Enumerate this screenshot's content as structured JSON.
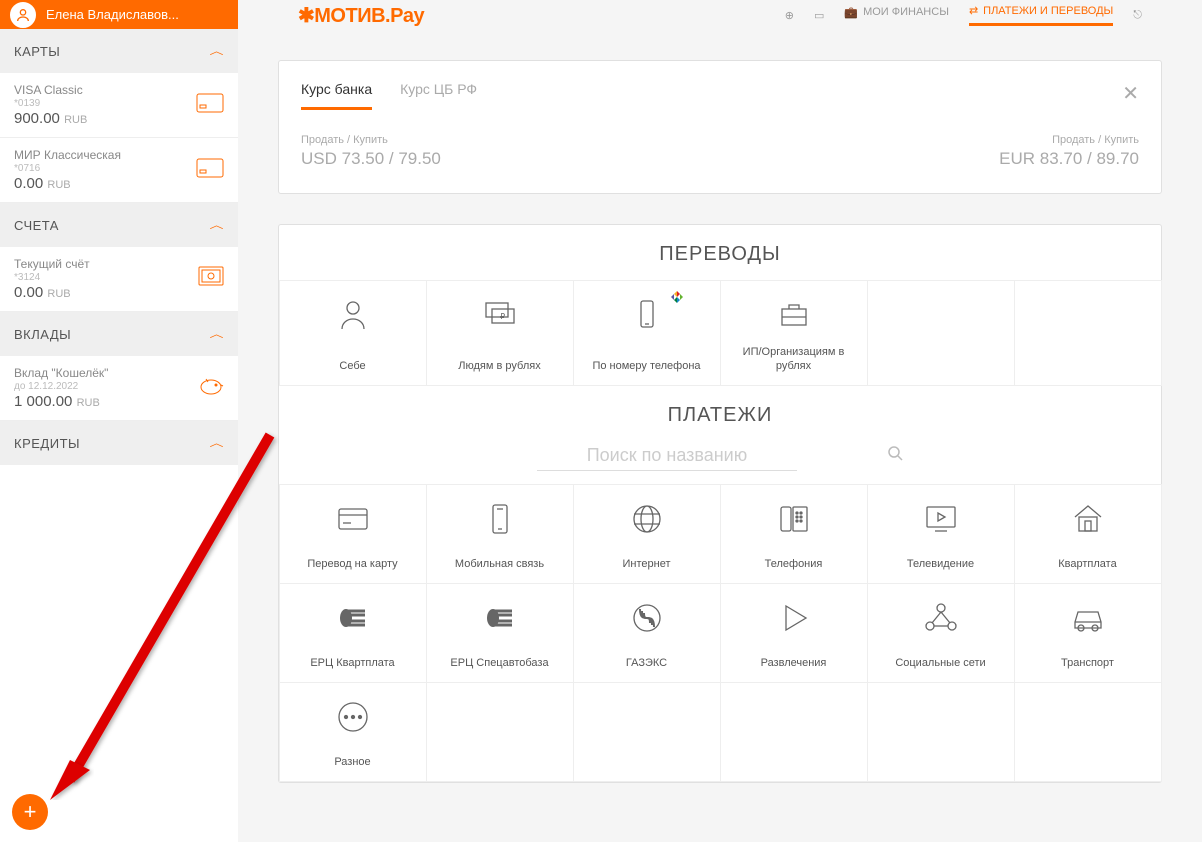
{
  "user": {
    "name": "Елена Владиславов..."
  },
  "logo": "✱МОТИВ.Pay",
  "topnav": {
    "finance": "МОИ ФИНАНСЫ",
    "payments": "ПЛАТЕЖИ И ПЕРЕВОДЫ"
  },
  "sidebar": {
    "sections": {
      "cards": "КАРТЫ",
      "accounts": "СЧЕТА",
      "deposits": "ВКЛАДЫ",
      "credits": "КРЕДИТЫ"
    },
    "cards": [
      {
        "name": "VISA Classic",
        "num": "*0139",
        "balance": "900.00",
        "cur": "RUB"
      },
      {
        "name": "МИР Классическая",
        "num": "*0716",
        "balance": "0.00",
        "cur": "RUB"
      }
    ],
    "accounts": [
      {
        "name": "Текущий счёт",
        "num": "*3124",
        "balance": "0.00",
        "cur": "RUB"
      }
    ],
    "deposits": [
      {
        "name": "Вклад \"Кошелёк\"",
        "num": "до 12.12.2022",
        "balance": "1 000.00",
        "cur": "RUB"
      }
    ]
  },
  "rates": {
    "tabs": {
      "bank": "Курс банка",
      "cbrf": "Курс ЦБ РФ"
    },
    "label": "Продать / Купить",
    "usd": "USD 73.50 / 79.50",
    "eur": "EUR 83.70 / 89.70"
  },
  "transfers": {
    "title": "ПЕРЕВОДЫ",
    "items": [
      "Себе",
      "Людям в рублях",
      "По номеру телефона",
      "ИП/Организациям в рублях"
    ]
  },
  "payments": {
    "title": "ПЛАТЕЖИ",
    "search_placeholder": "Поиск по названию",
    "items": [
      "Перевод на карту",
      "Мобильная связь",
      "Интернет",
      "Телефония",
      "Телевидение",
      "Квартплата",
      "ЕРЦ Квартплата",
      "ЕРЦ Спецавтобаза",
      "ГАЗЭКС",
      "Развлечения",
      "Социальные сети",
      "Транспорт",
      "Разное"
    ]
  }
}
